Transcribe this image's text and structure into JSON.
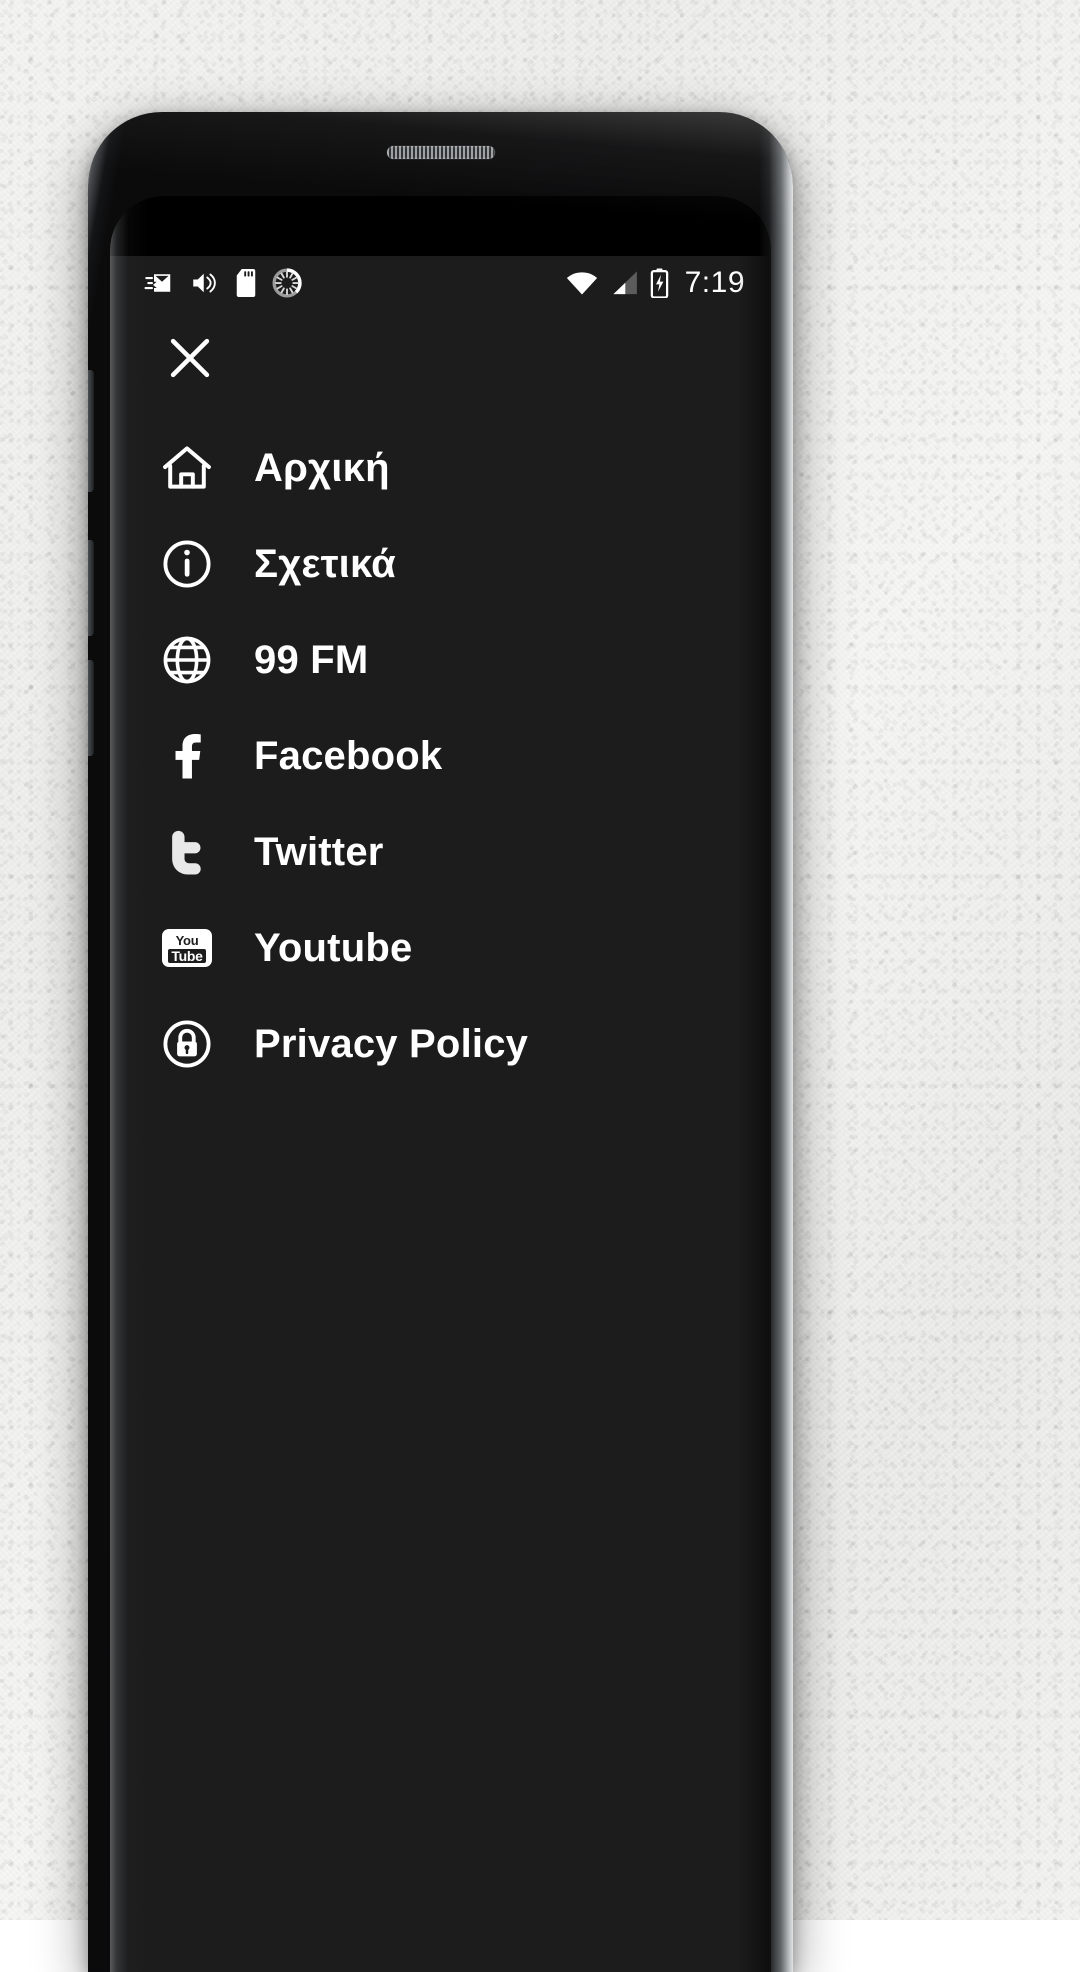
{
  "status_bar": {
    "time": "7:19",
    "left_icons": [
      {
        "name": "mail-icon",
        "label": "Mail"
      },
      {
        "name": "volume-icon",
        "label": "Volume"
      },
      {
        "name": "sd-card-icon",
        "label": "SD card"
      },
      {
        "name": "sync-spinner-icon",
        "label": "Syncing"
      }
    ],
    "right_icons": [
      {
        "name": "wifi-icon",
        "label": "Wi-Fi"
      },
      {
        "name": "cellular-signal-icon",
        "label": "Signal"
      },
      {
        "name": "battery-charging-icon",
        "label": "Battery charging"
      }
    ]
  },
  "drawer": {
    "close_label": "Close",
    "items": [
      {
        "label": "Αρχική",
        "icon": "home-icon"
      },
      {
        "label": "Σχετικά",
        "icon": "info-circle-icon"
      },
      {
        "label": "99 FM",
        "icon": "globe-icon"
      },
      {
        "label": "Facebook",
        "icon": "facebook-icon"
      },
      {
        "label": "Twitter",
        "icon": "twitter-icon"
      },
      {
        "label": "Youtube",
        "icon": "youtube-icon"
      },
      {
        "label": "Privacy Policy",
        "icon": "lock-circle-icon"
      }
    ]
  },
  "theme": {
    "screen_background": "#1c1c1c",
    "text_color": "#ffffff",
    "wall_color": "#f1f1f0"
  },
  "youtube_glyph": {
    "top": "You",
    "bottom": "Tube"
  }
}
